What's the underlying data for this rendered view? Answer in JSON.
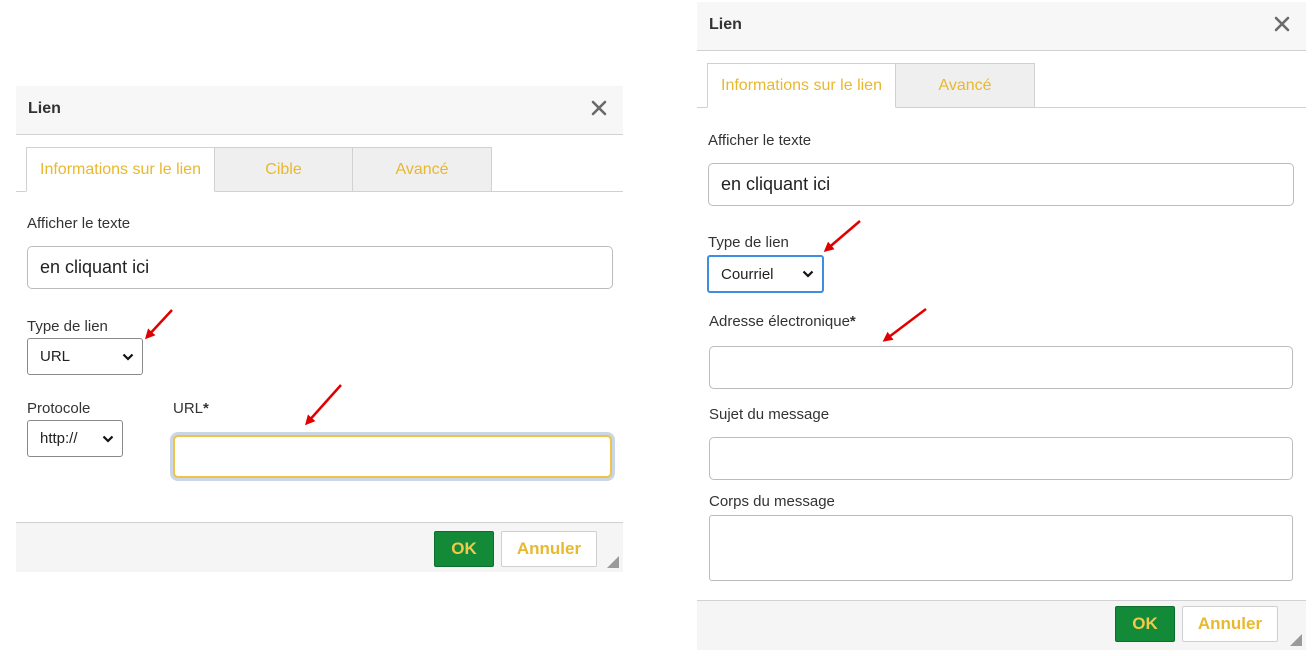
{
  "colors": {
    "accent_text": "#e8b82e",
    "ok_button_bg": "#138a38",
    "annotation_arrow": "#e00000",
    "focus_border": "#f0c24b",
    "select_focus_border": "#3d8de0"
  },
  "icons": {
    "close": "close-icon",
    "chevron": "chevron-down-icon",
    "resize": "resize-grip-icon",
    "annotation": "red-arrow-annotation"
  },
  "dialog_left": {
    "title": "Lien",
    "tabs": [
      {
        "label": "Informations sur le lien",
        "active": true
      },
      {
        "label": "Cible",
        "active": false
      },
      {
        "label": "Avancé",
        "active": false
      }
    ],
    "display_text": {
      "label": "Afficher le texte",
      "value": "en cliquant ici"
    },
    "link_type": {
      "label": "Type de lien",
      "value": "URL"
    },
    "protocol": {
      "label": "Protocole",
      "value": "http://"
    },
    "url": {
      "label": "URL",
      "required_mark": "*",
      "value": ""
    },
    "ok_label": "OK",
    "cancel_label": "Annuler"
  },
  "dialog_right": {
    "title": "Lien",
    "tabs": [
      {
        "label": "Informations sur le lien",
        "active": true
      },
      {
        "label": "Avancé",
        "active": false
      }
    ],
    "display_text": {
      "label": "Afficher le texte",
      "value": "en cliquant ici"
    },
    "link_type": {
      "label": "Type de lien",
      "value": "Courriel"
    },
    "email": {
      "label": "Adresse électronique",
      "required_mark": "*",
      "value": ""
    },
    "subject": {
      "label": "Sujet du message",
      "value": ""
    },
    "body": {
      "label": "Corps du message",
      "value": ""
    },
    "ok_label": "OK",
    "cancel_label": "Annuler"
  }
}
